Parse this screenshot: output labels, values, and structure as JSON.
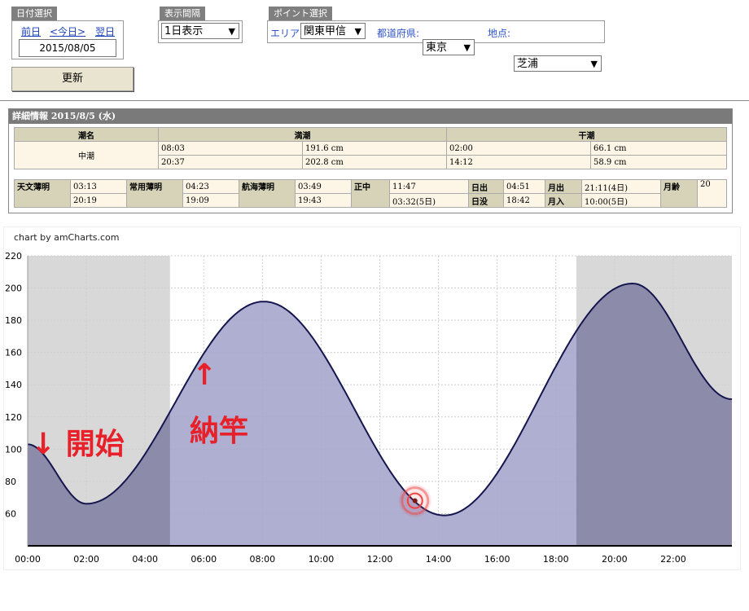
{
  "date_panel": {
    "label": "日付選択",
    "prev": "前日",
    "today": "<今日>",
    "next": "翌日",
    "date": "2015/08/05"
  },
  "update_button": "更新",
  "interval_panel": {
    "label": "表示間隔",
    "selected": "1日表示"
  },
  "point_panel": {
    "label": "ポイント選択",
    "area_label": "エリア:",
    "area": "関東甲信",
    "pref_label": "都道府県:",
    "pref": "東京",
    "point_label": "地点:",
    "point": "芝浦"
  },
  "detail": {
    "title": "詳細情報 2015/8/5 (水)",
    "headers": [
      "潮名",
      "満潮",
      "干潮"
    ],
    "tide_name": "中潮",
    "high": [
      {
        "time": "08:03",
        "height": "191.6 cm"
      },
      {
        "time": "20:37",
        "height": "202.8 cm"
      }
    ],
    "low": [
      {
        "time": "02:00",
        "height": "66.1 cm"
      },
      {
        "time": "14:12",
        "height": "58.9 cm"
      }
    ],
    "astro": [
      {
        "label": "天文薄明",
        "v1": "03:13",
        "v2": "20:19"
      },
      {
        "label": "常用薄明",
        "v1": "04:23",
        "v2": "19:09"
      },
      {
        "label": "航海薄明",
        "v1": "03:49",
        "v2": "19:43"
      },
      {
        "label": "正中",
        "v1": "11:47",
        "v2": "03:32(5日)"
      }
    ],
    "sun": {
      "rise_label": "日出",
      "rise": "04:51",
      "set_label": "日没",
      "set": "18:42"
    },
    "moon": {
      "rise_label": "月出",
      "rise": "21:11(4日)",
      "set_label": "月入",
      "set": "10:00(5日)"
    },
    "age_label": "月齢",
    "age": "20"
  },
  "credit": "chart by amCharts.com",
  "annotations": {
    "start": "↓ 開始",
    "end_arrow": "↑",
    "end": "納竿"
  },
  "chart_data": {
    "type": "area",
    "xlabel": "",
    "ylabel": "",
    "x_ticks": [
      "00:00",
      "02:00",
      "04:00",
      "06:00",
      "08:00",
      "10:00",
      "12:00",
      "14:00",
      "16:00",
      "18:00",
      "20:00",
      "22:00"
    ],
    "y_ticks": [
      60,
      80,
      100,
      120,
      140,
      160,
      180,
      200,
      220
    ],
    "xlim_hours": [
      0,
      24
    ],
    "ylim": [
      40,
      220
    ],
    "extrema": [
      {
        "h": 0,
        "v": 103
      },
      {
        "h": 2.0,
        "v": 66.1
      },
      {
        "h": 8.05,
        "v": 191.6
      },
      {
        "h": 14.2,
        "v": 58.9
      },
      {
        "h": 20.617,
        "v": 202.8
      },
      {
        "h": 24,
        "v": 131
      }
    ],
    "night_shading": [
      {
        "from": 0,
        "to": 4.85
      },
      {
        "from": 18.7,
        "to": 24
      }
    ],
    "marker": {
      "h": 13.2,
      "v": 68
    },
    "colors": {
      "line": "#16164f",
      "fill": "#a5a6cc",
      "night_fill": "#8c8caa",
      "night_bg": "#d8d8d8",
      "marker": "#e44"
    }
  }
}
